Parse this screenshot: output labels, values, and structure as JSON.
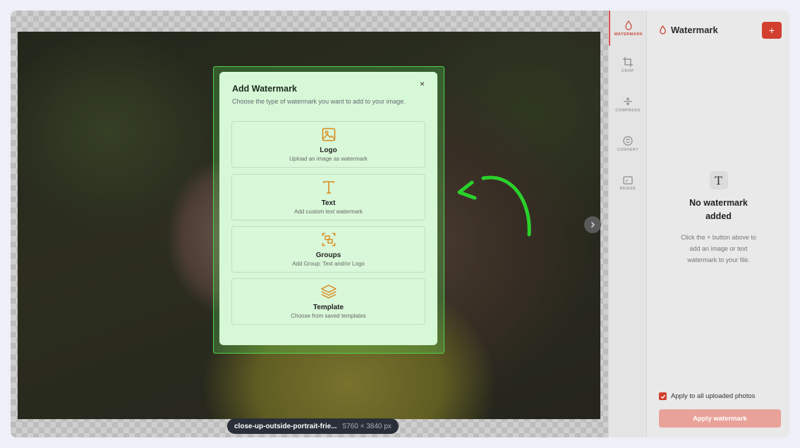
{
  "toolbar": {
    "items": [
      {
        "label": "WATERMARK",
        "icon": "droplet-icon",
        "active": true
      },
      {
        "label": "CROP",
        "icon": "crop-icon"
      },
      {
        "label": "COMPRESS",
        "icon": "compress-icon"
      },
      {
        "label": "CONVERT",
        "icon": "convert-icon"
      },
      {
        "label": "RESIZE",
        "icon": "resize-icon"
      }
    ]
  },
  "panel": {
    "title": "Watermark",
    "add_label": "+",
    "empty_title": "No watermark added",
    "empty_text": "Click the + button above to add an image or text watermark to your file.",
    "apply_all_label": "Apply to all uploaded photos",
    "apply_all_checked": true,
    "apply_button": "Apply watermark"
  },
  "file": {
    "name": "close-up-outside-portrait-frie...",
    "dimensions": "5760 × 3840 px"
  },
  "modal": {
    "title": "Add Watermark",
    "subtitle": "Choose the type of watermark you want to add to your image.",
    "close": "×",
    "options": [
      {
        "name": "Logo",
        "desc": "Upload an image as watermark",
        "icon": "image-icon"
      },
      {
        "name": "Text",
        "desc": "Add custom text watermark",
        "icon": "text-icon"
      },
      {
        "name": "Groups",
        "desc": "Add Group: Text and/or Logo",
        "icon": "group-icon"
      },
      {
        "name": "Template",
        "desc": "Choose from saved templates",
        "icon": "layers-icon"
      }
    ]
  },
  "colors": {
    "accent": "#d23f2f",
    "icon": "#d98a1c",
    "highlight": "#4fd24f"
  }
}
